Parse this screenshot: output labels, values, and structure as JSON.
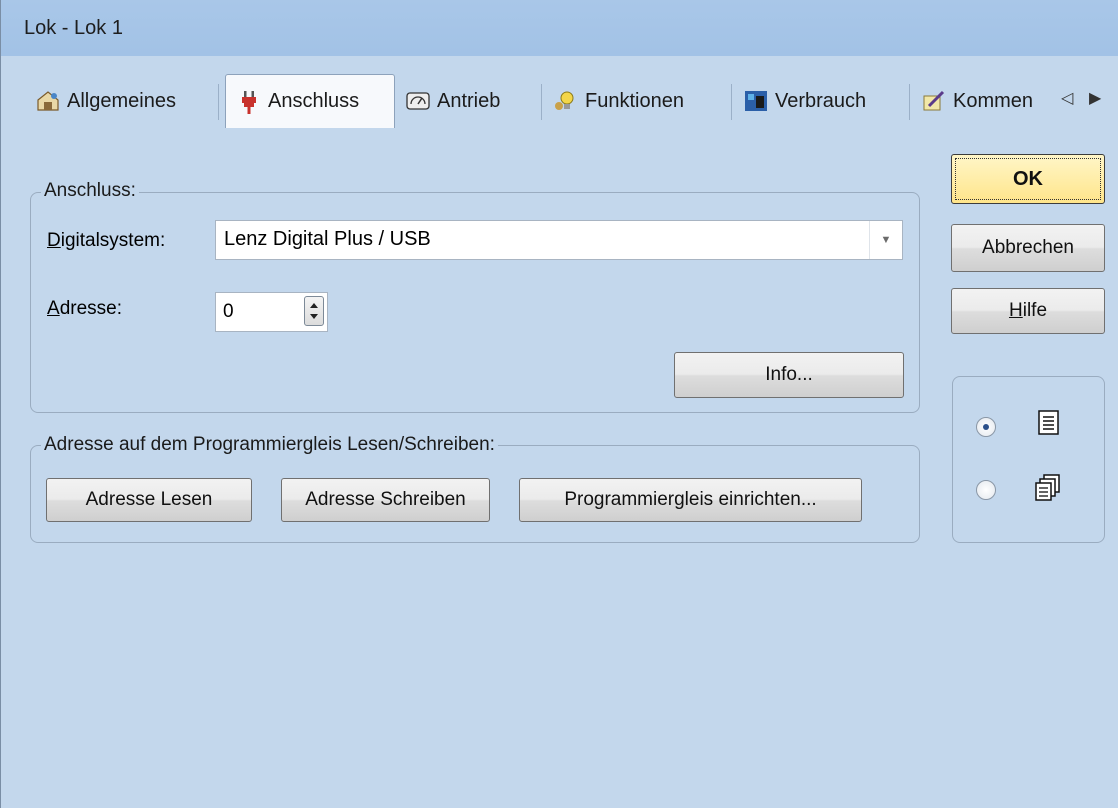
{
  "window": {
    "title": "Lok - Lok 1"
  },
  "tabs": [
    {
      "label": "Allgemeines",
      "icon": "general-settings-icon"
    },
    {
      "label": "Anschluss",
      "icon": "plug-icon",
      "active": true
    },
    {
      "label": "Antrieb",
      "icon": "gauge-icon"
    },
    {
      "label": "Funktionen",
      "icon": "functions-icon"
    },
    {
      "label": "Verbrauch",
      "icon": "consumption-icon"
    },
    {
      "label": "Kommen",
      "icon": "comment-icon"
    }
  ],
  "tab_scroll": {
    "left": "◁",
    "right": "▶"
  },
  "connection_group": {
    "title": "Anschluss:",
    "digitalsystem_label_mnemonic": "D",
    "digitalsystem_label_rest": "igitalsystem:",
    "digitalsystem_value": "Lenz Digital Plus / USB",
    "address_label_mnemonic": "A",
    "address_label_rest": "dresse:",
    "address_value": "0",
    "info_button": "Info..."
  },
  "programming_group": {
    "title": "Adresse auf dem Programmiergleis Lesen/Schreiben:",
    "read_button": "Adresse Lesen",
    "write_button": "Adresse Schreiben",
    "setup_button": "Programmiergleis einrichten..."
  },
  "dialog_buttons": {
    "ok": "OK",
    "cancel": "Abbrechen",
    "help_mnemonic": "H",
    "help_rest": "ilfe"
  },
  "view_mode": {
    "options": [
      {
        "icon": "single-page-icon",
        "checked": true
      },
      {
        "icon": "multi-page-icon",
        "checked": false
      }
    ]
  },
  "colors": {
    "background": "#c3d7ec",
    "titlebar": "#a9c7e8",
    "ok_button": "#ffe58a"
  }
}
